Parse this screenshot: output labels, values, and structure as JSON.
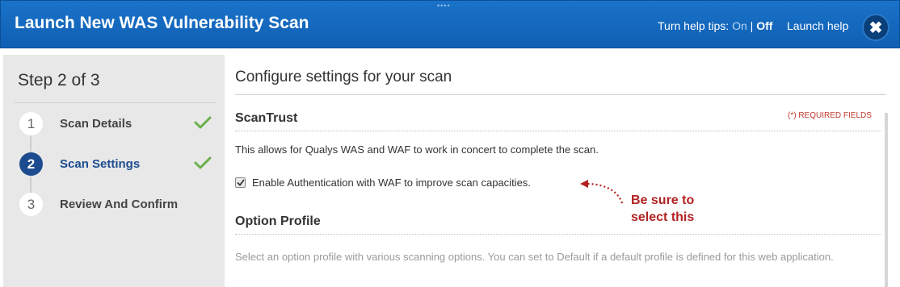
{
  "window": {
    "title": "Launch New WAS Vulnerability Scan",
    "help_tips_label": "Turn help tips:",
    "help_on": "On",
    "help_separator": "|",
    "help_off": "Off",
    "launch_help": "Launch help",
    "close_glyph": "✖"
  },
  "sidebar": {
    "heading": "Step 2 of 3",
    "steps": [
      {
        "number": "1",
        "label": "Scan Details",
        "completed": true,
        "active": false
      },
      {
        "number": "2",
        "label": "Scan Settings",
        "completed": true,
        "active": true
      },
      {
        "number": "3",
        "label": "Review And Confirm",
        "completed": false,
        "active": false
      }
    ]
  },
  "main": {
    "title": "Configure settings for your scan",
    "required_fields": "(*) REQUIRED FIELDS",
    "scantrust": {
      "heading": "ScanTrust",
      "description": "This allows for Qualys WAS and WAF to work in concert to complete the scan.",
      "checkbox_label": "Enable Authentication with WAF to improve scan capacities.",
      "checkbox_checked": true
    },
    "annotation": {
      "line1": "Be sure to",
      "line2": "select this"
    },
    "option_profile": {
      "heading": "Option Profile",
      "description": "Select an option profile with various scanning options. You can set to Default if a default profile is defined for this web application."
    }
  },
  "colors": {
    "titlebar": "#1a73c9",
    "active_step": "#1c4c8f",
    "check_green": "#6ab04c",
    "annotation_red": "#b22222"
  },
  "icons": {
    "close": "close-icon",
    "check": "checkmark-icon",
    "arrow": "dotted-arrow-icon"
  }
}
